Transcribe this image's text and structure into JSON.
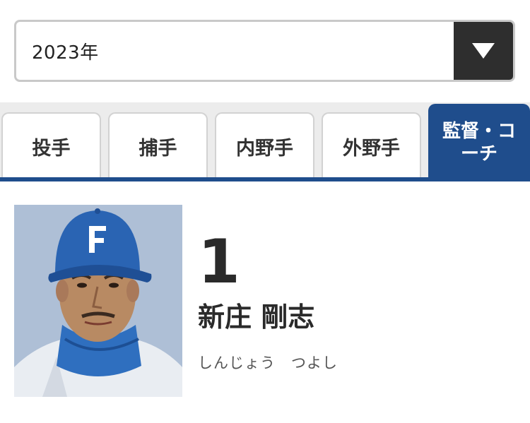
{
  "year_select": {
    "value": "2023年",
    "arrow_icon": "triangle-down-icon"
  },
  "tabs": [
    {
      "label": "投手",
      "active": false
    },
    {
      "label": "捕手",
      "active": false
    },
    {
      "label": "内野手",
      "active": false
    },
    {
      "label": "外野手",
      "active": false
    },
    {
      "label": "監督・コーチ",
      "active": true
    }
  ],
  "player": {
    "number": "1",
    "name": "新庄 剛志",
    "reading": "しんじょう　つよし"
  },
  "colors": {
    "accent": "#1f4d8c",
    "select_button": "#2e2e2e",
    "tab_band": "#ececec"
  }
}
